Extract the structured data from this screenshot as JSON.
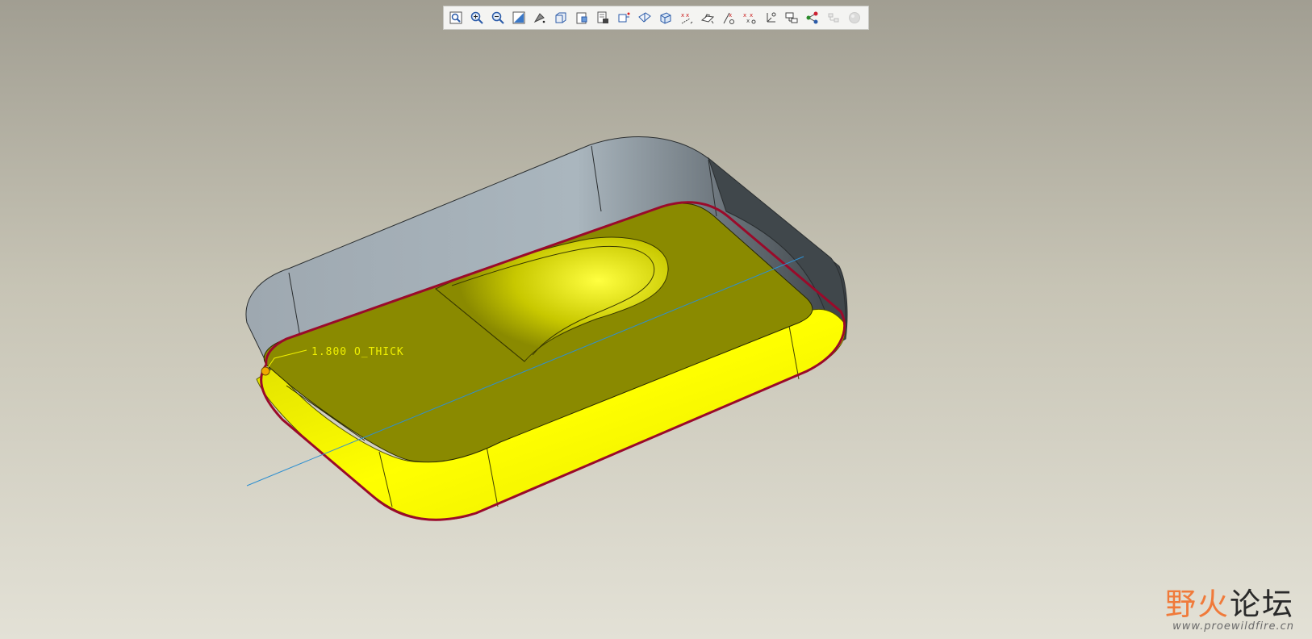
{
  "toolbar": {
    "buttons": [
      {
        "icon": "refit-icon"
      },
      {
        "icon": "zoom-in-icon"
      },
      {
        "icon": "zoom-out-icon"
      },
      {
        "icon": "repaint-icon"
      },
      {
        "icon": "display-style-icon"
      },
      {
        "icon": "saved-views-icon"
      },
      {
        "icon": "named-view-list-icon"
      },
      {
        "icon": "view-manager-icon"
      },
      {
        "icon": "spin-center-icon"
      },
      {
        "icon": "datum-plane-display-icon"
      },
      {
        "icon": "datum-axis-display-icon"
      },
      {
        "icon": "point-display-icon"
      },
      {
        "icon": "csys-display-icon"
      },
      {
        "icon": "annotation-display-icon"
      },
      {
        "icon": "point-tag-display-icon"
      },
      {
        "icon": "csys-tag-display-icon"
      },
      {
        "icon": "orient-mode-icon"
      },
      {
        "icon": "model-tree-icon"
      },
      {
        "icon": "network-icon"
      },
      {
        "icon": "layer-icon"
      },
      {
        "icon": "appearance-sphere-icon"
      }
    ]
  },
  "model": {
    "dimension_label": "1.800 O_THICK",
    "colors": {
      "top_face": "#8a8a00",
      "inner_wall": "#f2f200",
      "outer_wall": "#a8b4bc",
      "outer_wall_dark": "#3e4448",
      "highlight_edge": "#9a0a2a",
      "axis_line": "#2e8fd0",
      "dimension_text": "#f0f000"
    }
  },
  "watermark": {
    "title_a": "野火",
    "title_b": "论坛",
    "url": "www.proewildfire.cn"
  }
}
